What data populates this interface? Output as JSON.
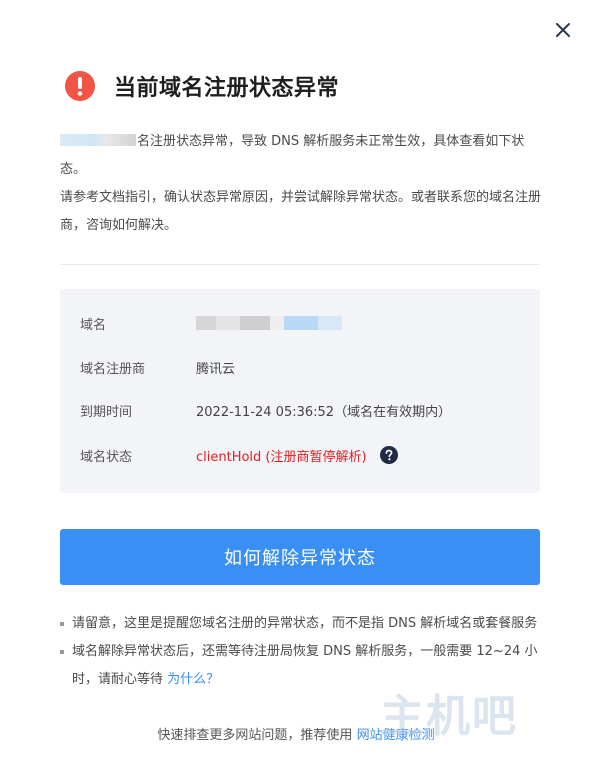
{
  "dialog": {
    "title": "当前域名注册状态异常",
    "description": {
      "line1": "名注册状态异常，导致 DNS 解析服务未正常生效，具体查看如下状态。",
      "line2": "请参考文档指引，确认状态异常原因，并尝试解除异常状态。或者联系您的域名注册商，咨询如何解决。"
    },
    "info": {
      "domain_label": "域名",
      "registrar_label": "域名注册商",
      "registrar_value": "腾讯云",
      "expiry_label": "到期时间",
      "expiry_value": "2022-11-24 05:36:52（域名在有效期内）",
      "status_label": "域名状态",
      "status_value": "clientHold (注册商暂停解析)"
    },
    "primary_button": "如何解除异常状态",
    "notes": [
      {
        "text": "请留意，这里是提醒您域名注册的异常状态，而不是指 DNS 解析域名或套餐服务"
      },
      {
        "text": "域名解除异常状态后，还需等待注册局恢复 DNS 解析服务，一般需要 12~24 小时，请耐心等待",
        "link": "为什么？"
      }
    ],
    "footer": {
      "text": "快速排查更多网站问题，推荐使用",
      "link": "网站健康检测"
    }
  },
  "watermark": "主机吧",
  "colors": {
    "accent": "#3a8ff5",
    "error": "#e02020",
    "alert_icon": "#f25545",
    "panel_bg": "#f2f4f8"
  },
  "icons": {
    "close": "close-icon",
    "alert": "exclamation-circle-icon",
    "help": "question-circle-icon"
  }
}
